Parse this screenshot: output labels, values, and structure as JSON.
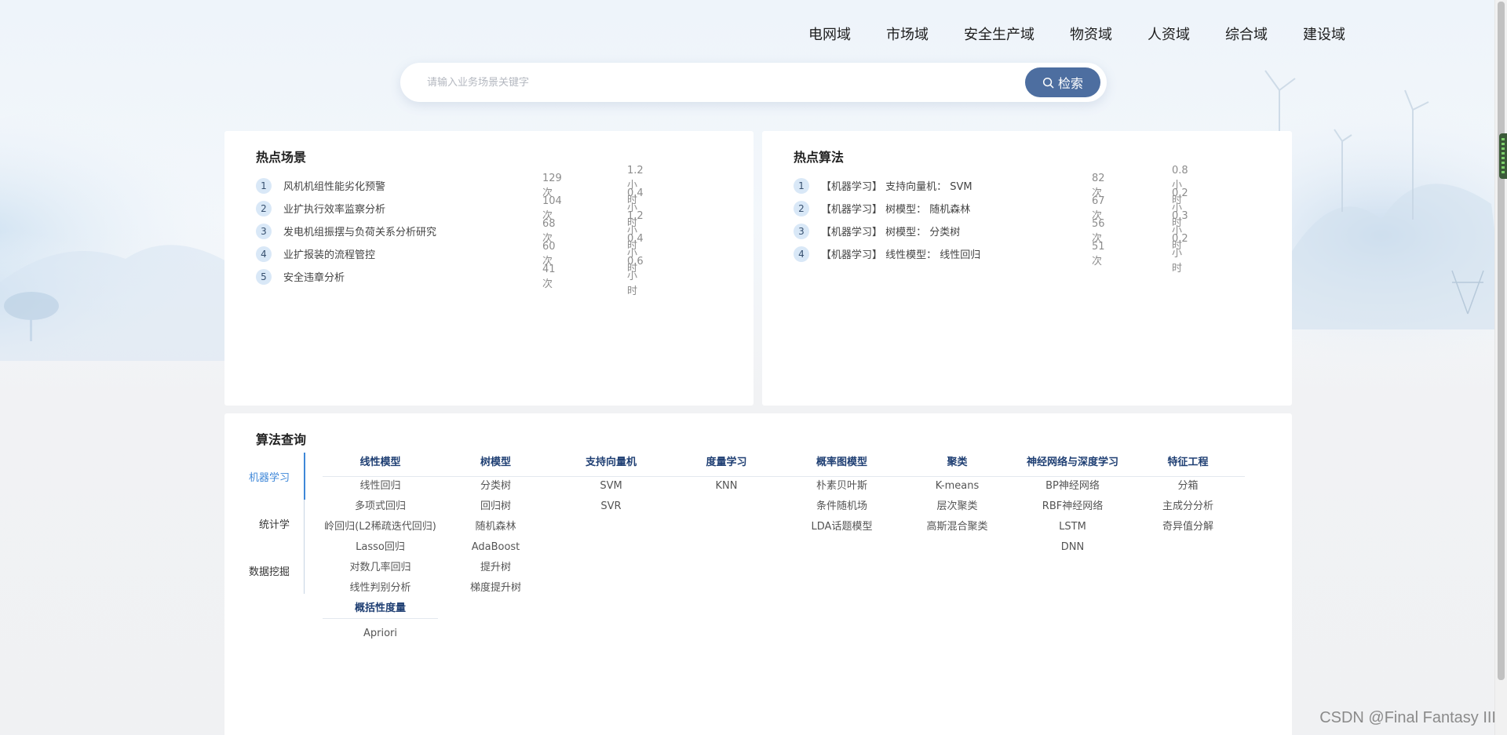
{
  "nav": {
    "items": [
      "电网域",
      "市场域",
      "安全生产域",
      "物资域",
      "人资域",
      "综合域",
      "建设域"
    ]
  },
  "search": {
    "placeholder": "请输入业务场景关键字",
    "button_label": "检索"
  },
  "hot_scenes": {
    "title": "热点场景",
    "items": [
      {
        "rank": "1",
        "name": "风机机组性能劣化预警",
        "count": "129次",
        "time": "1.2小时"
      },
      {
        "rank": "2",
        "name": "业扩执行效率监察分析",
        "count": "104次",
        "time": "0.4小时"
      },
      {
        "rank": "3",
        "name": "发电机组振摆与负荷关系分析研究",
        "count": "68次",
        "time": "1.2小时"
      },
      {
        "rank": "4",
        "name": "业扩报装的流程管控",
        "count": "60次",
        "time": "0.4小时"
      },
      {
        "rank": "5",
        "name": "安全违章分析",
        "count": "41次",
        "time": "0.6小时"
      }
    ]
  },
  "hot_algorithms": {
    "title": "热点算法",
    "items": [
      {
        "rank": "1",
        "name": "【机器学习】 支持向量机： SVM",
        "count": "82次",
        "time": "0.8小时"
      },
      {
        "rank": "2",
        "name": "【机器学习】 树模型： 随机森林",
        "count": "67次",
        "time": "0.2小时"
      },
      {
        "rank": "3",
        "name": "【机器学习】 树模型： 分类树",
        "count": "56次",
        "time": "0.3小时"
      },
      {
        "rank": "4",
        "name": "【机器学习】 线性模型： 线性回归",
        "count": "51次",
        "time": "0.2小时"
      }
    ]
  },
  "algo_query": {
    "title": "算法查询",
    "tabs": [
      "机器学习",
      "统计学",
      "数据挖掘"
    ],
    "active_tab": "机器学习",
    "columns": [
      {
        "head": "线性模型",
        "items": [
          "线性回归",
          "多项式回归",
          "岭回归(L2稀疏迭代回归)",
          "Lasso回归",
          "对数几率回归",
          "线性判别分析"
        ],
        "sub_head": "概括性度量",
        "sub_items": [
          "Apriori"
        ]
      },
      {
        "head": "树模型",
        "items": [
          "分类树",
          "回归树",
          "随机森林",
          "AdaBoost",
          "提升树",
          "梯度提升树"
        ]
      },
      {
        "head": "支持向量机",
        "items": [
          "SVM",
          "SVR"
        ]
      },
      {
        "head": "度量学习",
        "items": [
          "KNN"
        ]
      },
      {
        "head": "概率图模型",
        "items": [
          "朴素贝叶斯",
          "条件随机场",
          "LDA话题模型"
        ]
      },
      {
        "head": "聚类",
        "items": [
          "K-means",
          "层次聚类",
          "高斯混合聚类"
        ]
      },
      {
        "head": "神经网络与深度学习",
        "items": [
          "BP神经网络",
          "RBF神经网络",
          "LSTM",
          "DNN"
        ]
      },
      {
        "head": "特征工程",
        "items": [
          "分箱",
          "主成分分析",
          "奇异值分解"
        ]
      }
    ]
  },
  "watermark": "CSDN @Final Fantasy III",
  "colors": {
    "accent": "#4d6ea0",
    "active_tab": "#3e87d8",
    "column_head": "#1f3f73",
    "rank_badge": "#d9e8f7"
  }
}
